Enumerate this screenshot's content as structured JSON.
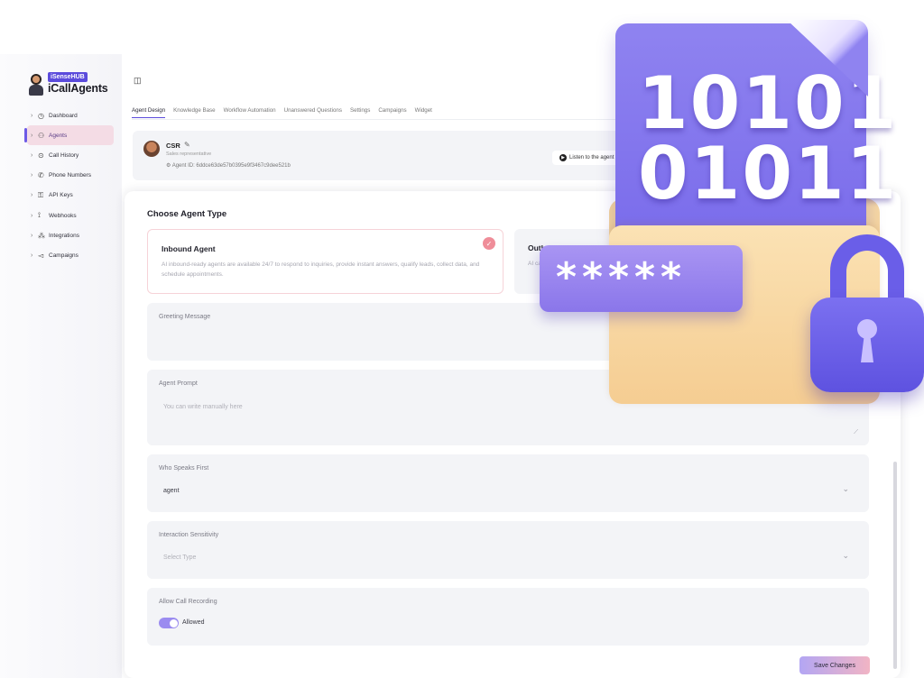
{
  "brand": {
    "badge": "iSenseHUB",
    "name": "iCallAgents"
  },
  "sidebar": {
    "items": [
      {
        "label": "Dashboard",
        "icon": "dashboard-icon",
        "glyph": "◷"
      },
      {
        "label": "Agents",
        "icon": "agents-icon",
        "glyph": "⚇",
        "active": true
      },
      {
        "label": "Call History",
        "icon": "clock-icon",
        "glyph": "⊙"
      },
      {
        "label": "Phone Numbers",
        "icon": "phone-icon",
        "glyph": "✆"
      },
      {
        "label": "API Keys",
        "icon": "key-icon",
        "glyph": "⚿"
      },
      {
        "label": "Webhooks",
        "icon": "webhook-icon",
        "glyph": "⟟"
      },
      {
        "label": "Integrations",
        "icon": "integrations-icon",
        "glyph": "⁂"
      },
      {
        "label": "Campaigns",
        "icon": "campaign-icon",
        "glyph": "◅"
      }
    ]
  },
  "tabs": [
    "Agent Design",
    "Knowledge Base",
    "Workflow Automation",
    "Unanswered Questions",
    "Settings",
    "Campaigns",
    "Widget"
  ],
  "agent": {
    "name": "CSR",
    "role": "Sales representative",
    "id": "Agent ID: 6ddce63de57b0395e9f3467c9dee521b",
    "listen_label": "Listen to the agent"
  },
  "form": {
    "title": "Choose Agent Type",
    "inbound": {
      "title": "Inbound Agent",
      "desc": "AI inbound-ready agents are available 24/7 to respond to inquiries, provide instant answers, qualify leads, collect data, and schedule appointments."
    },
    "outbound": {
      "title": "Outbound Agent",
      "desc": "AI cal"
    },
    "greeting": {
      "label": "Greeting Message"
    },
    "prompt": {
      "label": "Agent Prompt",
      "placeholder": "You can write manually here"
    },
    "speaks_first": {
      "label": "Who Speaks First",
      "value": "agent"
    },
    "sensitivity": {
      "label": "Interaction Sensitivity",
      "placeholder": "Select Type"
    },
    "recording": {
      "label": "Allow Call Recording",
      "value": "Allowed",
      "enabled": true
    },
    "save_label": "Save Changes"
  },
  "illustration": {
    "binary_line1": "10101",
    "binary_line2": "01011",
    "password_mask": "*****"
  },
  "colors": {
    "accent": "#6d5ae6",
    "active_bg": "#f4dce5",
    "toggle": "#9b8cf0"
  }
}
